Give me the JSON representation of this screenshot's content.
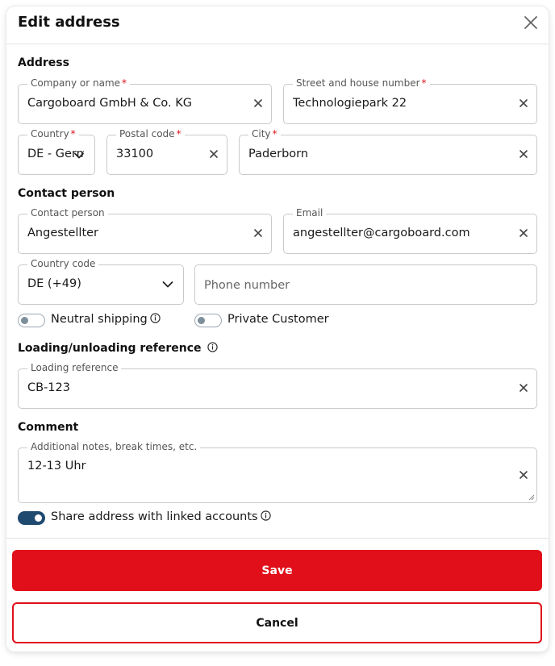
{
  "dialog": {
    "title": "Edit address"
  },
  "sections": {
    "address": "Address",
    "contact": "Contact person",
    "loading": "Loading/unloading reference",
    "comment": "Comment"
  },
  "fields": {
    "company": {
      "label": "Company or name",
      "value": "Cargoboard GmbH & Co. KG",
      "required": true
    },
    "street": {
      "label": "Street and house number",
      "value": "Technologiepark 22",
      "required": true
    },
    "country": {
      "label": "Country",
      "value": "DE - Germany",
      "required": true
    },
    "postal": {
      "label": "Postal code",
      "value": "33100",
      "required": true
    },
    "city": {
      "label": "City",
      "value": "Paderborn",
      "required": true
    },
    "contact_person": {
      "label": "Contact person",
      "value": "Angestellter"
    },
    "email": {
      "label": "Email",
      "value": "angestellter@cargoboard.com"
    },
    "country_code": {
      "label": "Country code",
      "value": "DE (+49)"
    },
    "phone": {
      "placeholder": "Phone number",
      "value": ""
    },
    "loading_reference": {
      "label": "Loading reference",
      "value": "CB-123"
    },
    "comment": {
      "label": "Additional notes, break times, etc.",
      "value": "12-13 Uhr"
    }
  },
  "toggles": {
    "neutral_shipping": {
      "label": "Neutral shipping",
      "on": false
    },
    "private_customer": {
      "label": "Private Customer",
      "on": false
    },
    "share_address": {
      "label": "Share address with linked accounts",
      "on": true
    }
  },
  "buttons": {
    "save": "Save",
    "cancel": "Cancel"
  },
  "colors": {
    "accent_red": "#e00f19",
    "toggle_on": "#1f4a6f"
  },
  "icons": [
    "close-icon",
    "clear-icon",
    "chevron-down-icon",
    "info-icon"
  ],
  "required_marker": "*"
}
